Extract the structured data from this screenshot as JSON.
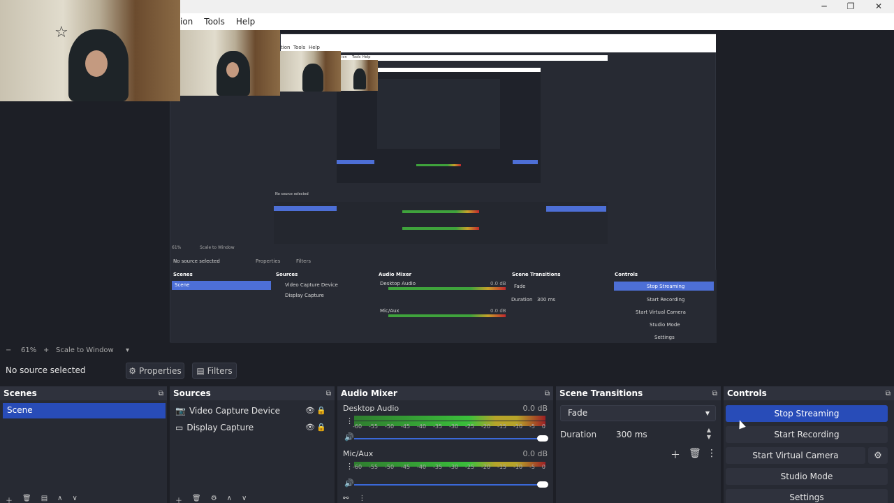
{
  "window": {
    "min_icon": "─",
    "max_icon": "❐",
    "close_icon": "✕"
  },
  "menubar": {
    "items": [
      "ion",
      "Tools",
      "Help"
    ]
  },
  "preview": {
    "zoom": "61%",
    "zoom_minus": "−",
    "zoom_plus": "+",
    "scale_mode": "Scale to Window",
    "caret": "▾"
  },
  "source_bar": {
    "status": "No source selected",
    "properties_label": "Properties",
    "filters_label": "Filters"
  },
  "scenes": {
    "title": "Scenes",
    "items": [
      "Scene"
    ]
  },
  "sources": {
    "title": "Sources",
    "items": [
      {
        "label": "Video Capture Device",
        "icon": "camera-icon"
      },
      {
        "label": "Display Capture",
        "icon": "monitor-icon"
      }
    ]
  },
  "audio_mixer": {
    "title": "Audio Mixer",
    "channels": [
      {
        "name": "Desktop Audio",
        "db": "0.0 dB",
        "volume": 1.0
      },
      {
        "name": "Mic/Aux",
        "db": "0.0 dB",
        "volume": 1.0
      }
    ],
    "scale": [
      "-60",
      "-55",
      "-50",
      "-45",
      "-40",
      "-35",
      "-30",
      "-25",
      "-20",
      "-15",
      "-10",
      "-5",
      "0"
    ]
  },
  "scene_transitions": {
    "title": "Scene Transitions",
    "transition": "Fade",
    "duration_label": "Duration",
    "duration_value": "300 ms"
  },
  "controls": {
    "title": "Controls",
    "stop_streaming": "Stop Streaming",
    "start_recording": "Start Recording",
    "start_virtual_camera": "Start Virtual Camera",
    "studio_mode": "Studio Mode",
    "settings": "Settings"
  },
  "mini": {
    "menu": [
      "tion",
      "Tools",
      "Help"
    ],
    "menu2": [
      "ion",
      "Tools",
      "Help"
    ],
    "zoom": "61%",
    "scale_mode": "Scale to Window",
    "status": "No source selected",
    "properties": "Properties",
    "filters": "Filters",
    "scenes": "Scenes",
    "scene": "Scene",
    "sources": "Sources",
    "src1": "Video Capture Device",
    "src2": "Display Capture",
    "audio_mixer": "Audio Mixer",
    "desktop_audio": "Desktop Audio",
    "mic": "Mic/Aux",
    "db": "0.0 dB",
    "transitions": "Scene Transitions",
    "fade": "Fade",
    "duration": "Duration",
    "duration_val": "300 ms",
    "controls": "Controls",
    "stop_streaming": "Stop Streaming",
    "start_recording": "Start Recording",
    "start_virtual_camera": "Start Virtual Camera",
    "studio_mode": "Studio Mode",
    "settings": "Settings"
  },
  "colors": {
    "accent": "#284cb8",
    "background": "#1d1f26",
    "panel": "#272a33"
  }
}
